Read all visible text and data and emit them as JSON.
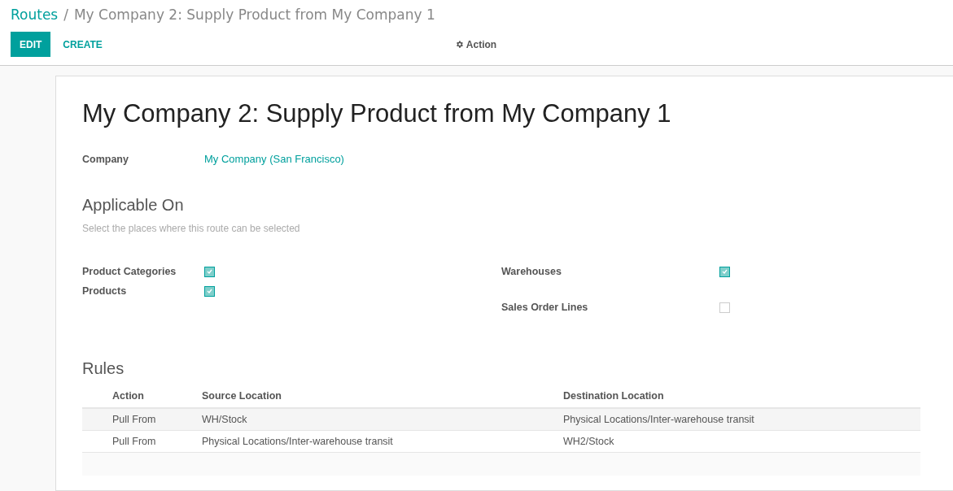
{
  "breadcrumb": {
    "parent": "Routes",
    "separator": "/",
    "current": "My Company 2: Supply Product from My Company 1"
  },
  "buttons": [
    "EDIT",
    "CREATE"
  ],
  "action_menu": {
    "label": "Action"
  },
  "record": {
    "title": "My Company 2: Supply Product from My Company 1",
    "company": {
      "label": "Company",
      "value": "My Company (San Francisco)"
    },
    "applicable_on": {
      "heading": "Applicable On",
      "hint": "Select the places where this route can be selected",
      "left": [
        {
          "label": "Product Categories",
          "checked": true
        },
        {
          "label": "Products",
          "checked": true
        }
      ],
      "right": [
        {
          "label": "Warehouses",
          "checked": true
        },
        {
          "label": "Sales Order Lines",
          "checked": false
        }
      ]
    },
    "rules": {
      "heading": "Rules",
      "columns": [
        "Action",
        "Source Location",
        "Destination Location"
      ],
      "rows": [
        [
          "Pull From",
          "WH/Stock",
          "Physical Locations/Inter-warehouse transit"
        ],
        [
          "Pull From",
          "Physical Locations/Inter-warehouse transit",
          "WH2/Stock"
        ]
      ]
    }
  }
}
